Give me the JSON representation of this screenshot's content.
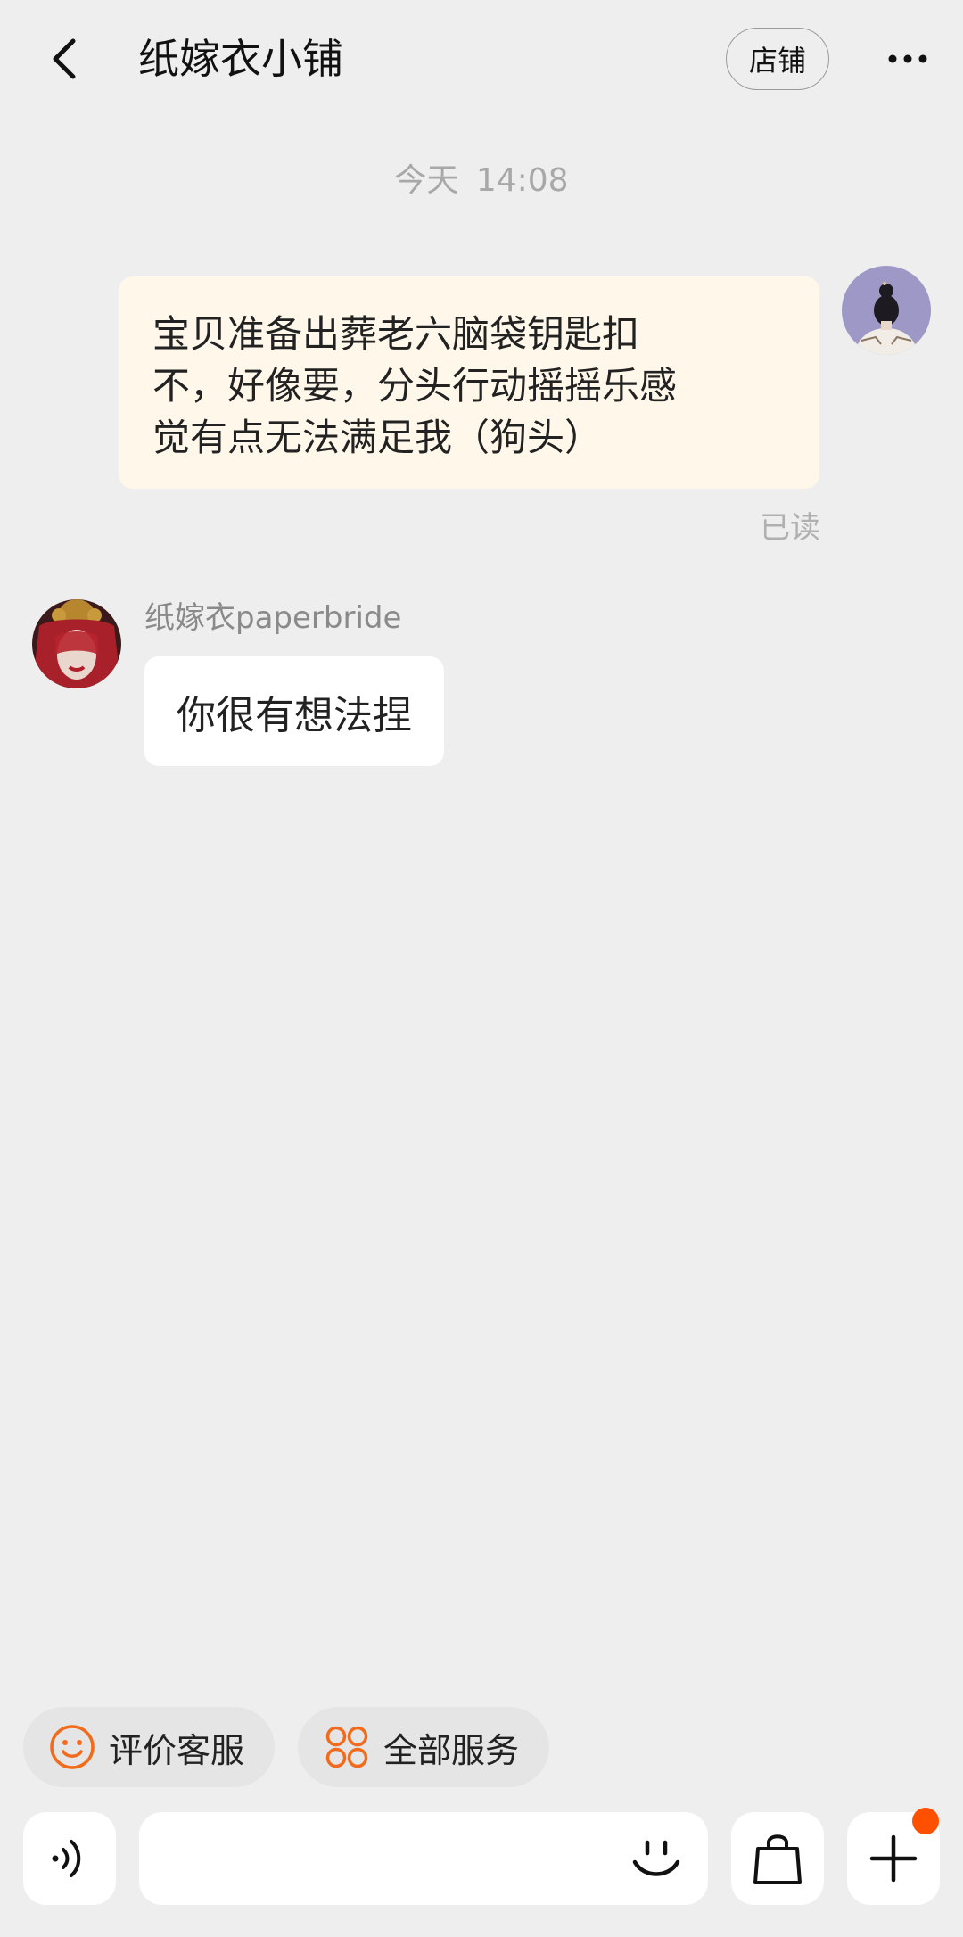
{
  "header": {
    "title": "纸嫁衣小铺",
    "shop_button": "店铺",
    "back_icon": "chevron-left-icon",
    "more_icon": "more-horizontal-icon"
  },
  "chat": {
    "timestamp": "今天 14:08",
    "outgoing": {
      "lines": [
        "宝贝准备出葬老六脑袋钥匙扣",
        "不，好像要，分头行动摇摇乐感",
        "觉有点无法满足我（狗头）"
      ],
      "status": "已读"
    },
    "incoming": {
      "sender": "纸嫁衣paperbride",
      "text": "你很有想法捏"
    }
  },
  "quick_actions": [
    {
      "label": "评价客服",
      "icon": "smiley-icon"
    },
    {
      "label": "全部服务",
      "icon": "grid-apps-icon"
    }
  ],
  "input_bar": {
    "placeholder": "",
    "voice_icon": "voice-icon",
    "emoji_icon": "emoji-icon",
    "bag_icon": "shopping-bag-icon",
    "plus_icon": "plus-icon"
  },
  "colors": {
    "background": "#eeeeee",
    "outgoing_bubble": "#fff8ea",
    "incoming_bubble": "#ffffff",
    "accent": "#ff5000"
  }
}
